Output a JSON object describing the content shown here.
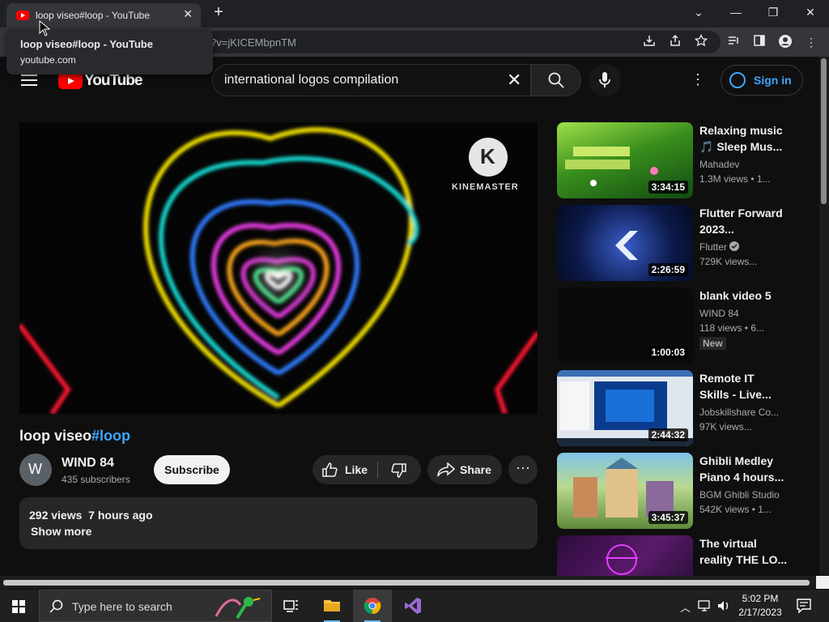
{
  "browser": {
    "tab_title": "loop viseo#loop - YouTube",
    "tab_close": "✕",
    "new_tab": "+",
    "window_controls": {
      "minimize": "—",
      "restore": "❐",
      "close": "✕",
      "tab_search": "⌄"
    },
    "url_visible": "?v=jKICEMbpnTM",
    "tooltip": {
      "title": "loop viseo#loop - YouTube",
      "domain": "youtube.com"
    }
  },
  "youtube": {
    "logo_text": "YouTube",
    "search": {
      "value": "international logos compilation",
      "clear": "✕"
    },
    "signin_label": "Sign in",
    "kebab": "⋮"
  },
  "player": {
    "watermark": "KINEMASTER",
    "watermark_letter": "K"
  },
  "video": {
    "title": "loop viseo",
    "hashtag": "#loop",
    "channel": "WIND 84",
    "channel_initial": "W",
    "subscribers": "435 subscribers",
    "subscribe_label": "Subscribe",
    "like_label": "Like",
    "share_label": "Share",
    "more": "···",
    "views": "292 views",
    "age": "7 hours ago",
    "show_more": "Show more"
  },
  "recommendations": [
    {
      "title_l1": "Relaxing music",
      "title_l2": "🎵 Sleep Mus...",
      "channel": "Mahadev",
      "meta": "1.3M views  • 1...",
      "duration": "3:34:15",
      "verified": false,
      "badge": ""
    },
    {
      "title_l1": "Flutter Forward",
      "title_l2": "2023...",
      "channel": "Flutter",
      "meta": "729K views...",
      "duration": "2:26:59",
      "verified": true,
      "badge": ""
    },
    {
      "title_l1": "blank video 5",
      "title_l2": "",
      "channel": "WIND 84",
      "meta": "118 views  • 6...",
      "duration": "1:00:03",
      "verified": false,
      "badge": "New"
    },
    {
      "title_l1": "Remote IT",
      "title_l2": "Skills - Live...",
      "channel": "Jobskillshare Co...",
      "meta": "97K views...",
      "duration": "2:44:32",
      "verified": false,
      "badge": ""
    },
    {
      "title_l1": "Ghibli Medley",
      "title_l2": "Piano 4 hours...",
      "channel": "BGM Ghibli Studio",
      "meta": "542K views  • 1...",
      "duration": "3:45:37",
      "verified": false,
      "badge": ""
    },
    {
      "title_l1": "The virtual",
      "title_l2": "reality THE LO...",
      "channel": "",
      "meta": "",
      "duration": "",
      "verified": false,
      "badge": ""
    }
  ],
  "taskbar": {
    "search_placeholder": "Type here to search",
    "time": "5:02 PM",
    "date": "2/17/2023"
  },
  "colors": {
    "accent_blue": "#3ea6ff",
    "youtube_red": "#ff0000",
    "bg": "#0f0f0f"
  }
}
